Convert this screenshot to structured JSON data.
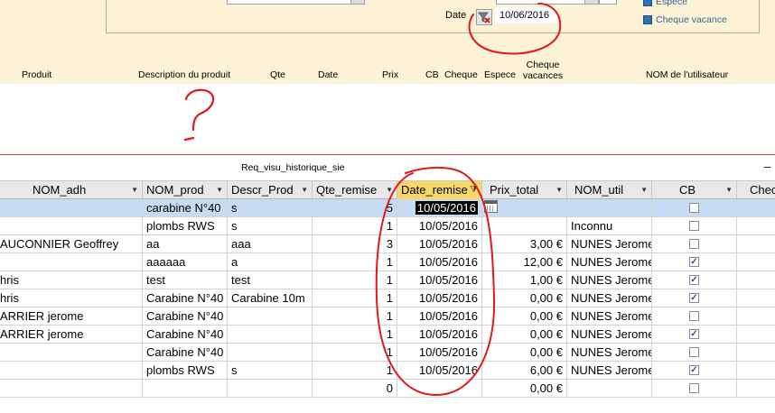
{
  "form": {
    "radio_options": [
      {
        "label": "Espece"
      },
      {
        "label": "Cheque vacance"
      }
    ],
    "date_label": "Date",
    "date_value": "10/06/2016",
    "columns": [
      {
        "label": "Produit"
      },
      {
        "label": "Description du produit"
      },
      {
        "label": "Qte"
      },
      {
        "label": "Date"
      },
      {
        "label": "Prix"
      },
      {
        "label": "CB"
      },
      {
        "label": "Cheque"
      },
      {
        "label": "Espece"
      },
      {
        "label": "Cheque vacances"
      },
      {
        "label": "NOM de l'utilisateur"
      }
    ]
  },
  "annotation": {
    "question_mark": "?"
  },
  "datasheet": {
    "title": "Req_visu_historique_sie",
    "minimize_label": "–",
    "headers": [
      {
        "label": "NOM_adh"
      },
      {
        "label": "NOM_prod"
      },
      {
        "label": "Descr_Prod"
      },
      {
        "label": "Qte_remise"
      },
      {
        "label": "Date_remise"
      },
      {
        "label": "Prix_total"
      },
      {
        "label": "NOM_util"
      },
      {
        "label": "CB"
      },
      {
        "label": "Chec"
      }
    ],
    "rows": [
      {
        "nom_adh": "",
        "nom_prod": "carabine N°40",
        "descr": "s",
        "qte": "5",
        "date": "10/05/2016",
        "prix": "",
        "nom_util": "",
        "cb": false
      },
      {
        "nom_adh": "",
        "nom_prod": "plombs RWS",
        "descr": "s",
        "qte": "1",
        "date": "10/05/2016",
        "prix": "",
        "nom_util": "Inconnu",
        "cb": false
      },
      {
        "nom_adh": "AUCONNIER Geoffrey",
        "nom_prod": "aa",
        "descr": "aaa",
        "qte": "3",
        "date": "10/05/2016",
        "prix": "3,00 €",
        "nom_util": "NUNES Jerome",
        "cb": false
      },
      {
        "nom_adh": "",
        "nom_prod": "aaaaaa",
        "descr": "a",
        "qte": "1",
        "date": "10/05/2016",
        "prix": "12,00 €",
        "nom_util": "NUNES Jerome",
        "cb": true
      },
      {
        "nom_adh": "hris",
        "nom_prod": "test",
        "descr": "test",
        "qte": "1",
        "date": "10/05/2016",
        "prix": "1,00 €",
        "nom_util": "NUNES Jerome",
        "cb": true
      },
      {
        "nom_adh": "hris",
        "nom_prod": "Carabine N°40",
        "descr": "Carabine 10m",
        "qte": "1",
        "date": "10/05/2016",
        "prix": "0,00 €",
        "nom_util": "NUNES Jerome",
        "cb": true
      },
      {
        "nom_adh": "ARRIER jerome",
        "nom_prod": "Carabine N°40",
        "descr": "",
        "qte": "1",
        "date": "10/05/2016",
        "prix": "0,00 €",
        "nom_util": "NUNES Jerome",
        "cb": false
      },
      {
        "nom_adh": "ARRIER jerome",
        "nom_prod": "Carabine N°40",
        "descr": "",
        "qte": "1",
        "date": "10/05/2016",
        "prix": "0,00 €",
        "nom_util": "NUNES Jerome",
        "cb": true
      },
      {
        "nom_adh": "",
        "nom_prod": "Carabine N°40",
        "descr": "",
        "qte": "1",
        "date": "10/05/2016",
        "prix": "0,00 €",
        "nom_util": "NUNES Jerome",
        "cb": false
      },
      {
        "nom_adh": "",
        "nom_prod": "plombs RWS",
        "descr": "s",
        "qte": "1",
        "date": "10/05/2016",
        "prix": "6,00 €",
        "nom_util": "NUNES Jerome",
        "cb": true
      },
      {
        "nom_adh": "",
        "nom_prod": "",
        "descr": "",
        "qte": "0",
        "date": "",
        "prix": "0,00 €",
        "nom_util": "",
        "cb": false
      }
    ]
  },
  "colors": {
    "form_bg": "#fcf3d6",
    "active_header": "#f7d76a",
    "selected_row": "#c7dcf3",
    "annotation_red": "#e0191b"
  }
}
